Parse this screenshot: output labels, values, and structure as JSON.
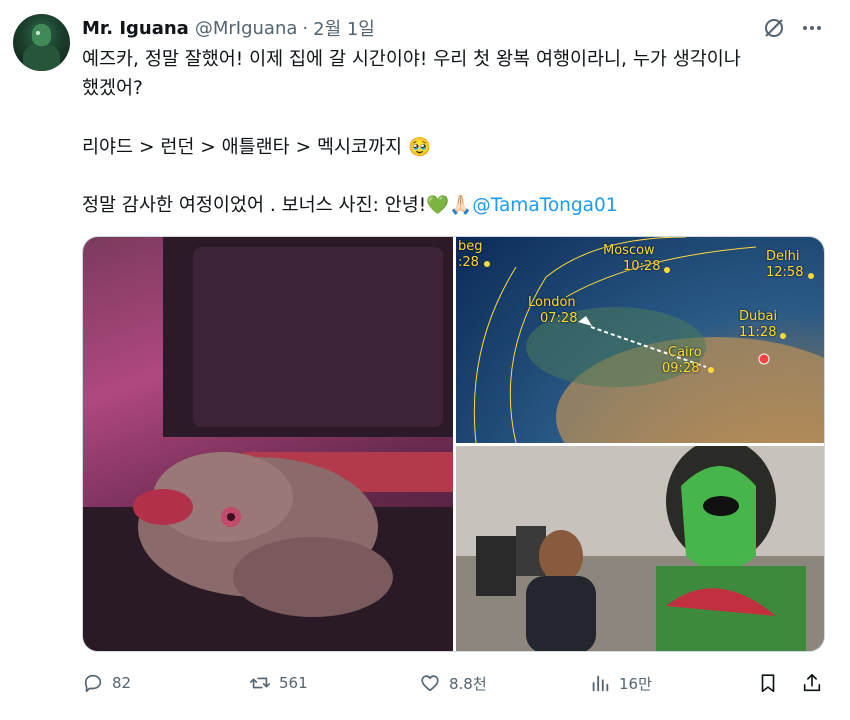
{
  "author": {
    "name": "Mr. Iguana",
    "handle": "@MrIguana",
    "separator": "·",
    "date": "2월 1일"
  },
  "tweet": {
    "line1": "예즈카, 정말 잘했어! 이제 집에 갈 시간이야! 우리 첫 왕복 여행이라니, 누가 생각이나",
    "line2": "했겠어?",
    "line3": "리야드 > 런던 > 애틀랜타 > 멕시코까지 🥹",
    "line4_text": "정말 감사한 여정이었어 . 보너스 사진: 안녕!💚🙏🏻",
    "line4_mention": "@TamaTonga01"
  },
  "map_labels": [
    {
      "city": "beg",
      "time": ":28"
    },
    {
      "city": "Moscow",
      "time": "10:28"
    },
    {
      "city": "Delhi",
      "time": "12:58"
    },
    {
      "city": "London",
      "time": "07:28"
    },
    {
      "city": "Dubai",
      "time": "11:28"
    },
    {
      "city": "Cairo",
      "time": "09:28"
    }
  ],
  "actions": {
    "replies": "82",
    "retweets": "561",
    "likes": "8.8천",
    "views": "16만"
  },
  "icons": [
    "grok-icon",
    "more-icon",
    "reply-icon",
    "retweet-icon",
    "like-icon",
    "views-icon",
    "bookmark-icon",
    "share-icon"
  ]
}
